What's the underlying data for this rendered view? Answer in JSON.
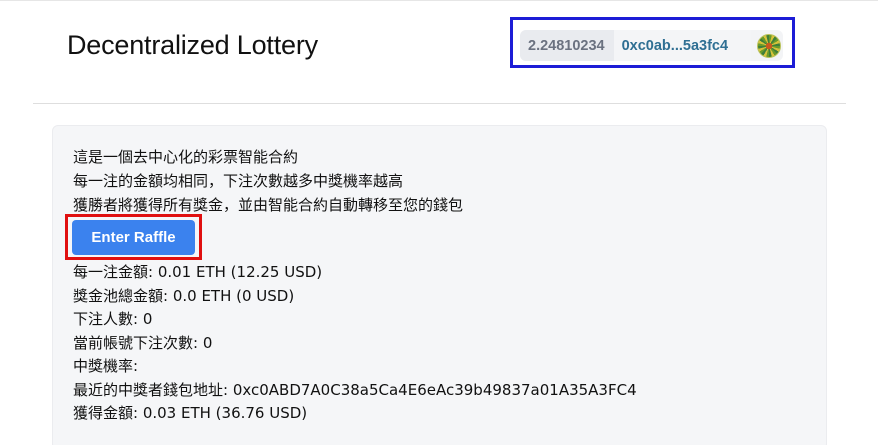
{
  "header": {
    "title": "Decentralized Lottery",
    "wallet": {
      "balance": "2.24810234",
      "address": "0xc0ab...5a3fc4",
      "avatar_icon": "identicon-avatar"
    }
  },
  "intro": {
    "lines": [
      "這是一個去中心化的彩票智能合約",
      "每一注的金額均相同，下注次數越多中獎機率越高",
      "獲勝者將獲得所有獎金，並由智能合約自動轉移至您的錢包"
    ]
  },
  "actions": {
    "enter_label": "Enter Raffle"
  },
  "stats": [
    "每一注金額: 0.01 ETH (12.25 USD)",
    "獎金池總金額: 0.0 ETH (0 USD)",
    "下注人數: 0",
    "當前帳號下注次數: 0",
    "中獎機率:",
    "最近的中獎者錢包地址: 0xc0ABD7A0C38a5Ca4E6eAc39b49837a01A35A3FC4",
    "獲得金額: 0.03 ETH (36.76 USD)"
  ],
  "colors": {
    "primary_button": "#3b82ee",
    "wallet_highlight": "#1c1cd6",
    "button_highlight": "#e01010",
    "address_text": "#2f6f93"
  }
}
